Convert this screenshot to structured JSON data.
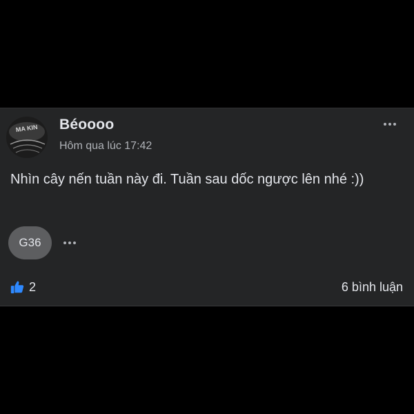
{
  "post": {
    "author": "Béoooo",
    "timestamp": "Hôm qua lúc 17:42",
    "text": "Nhìn cây nến tuần này đi. Tuần sau dốc ngược lên nhé :))",
    "tag": "G36",
    "likes": "2",
    "comments": "6 bình luận",
    "avatar_text": "MA KIN"
  },
  "colors": {
    "background": "#000000",
    "card": "#242526",
    "primary_text": "#e4e6eb",
    "secondary_text": "#b0b3b8",
    "pill": "#5d5e60",
    "like_blue": "#2e89ff"
  },
  "icons": {
    "more": "more-horizontal-icon",
    "like": "thumbs-up-icon"
  }
}
